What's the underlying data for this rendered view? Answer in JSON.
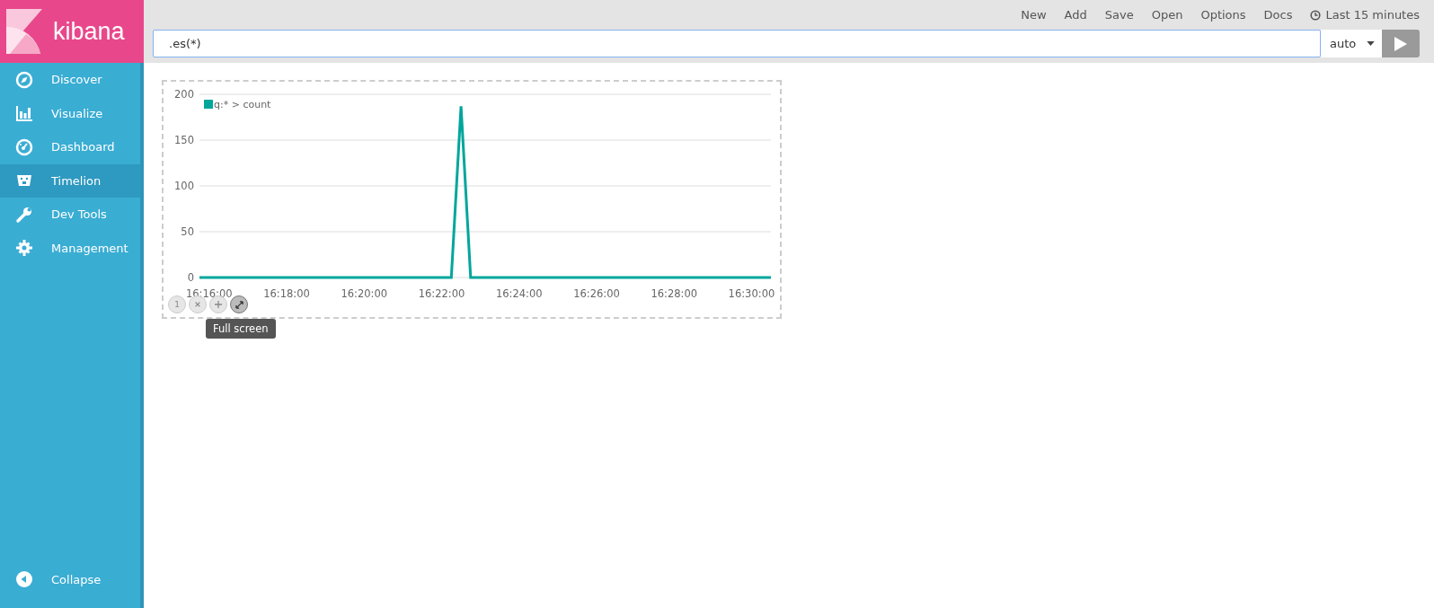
{
  "brand": {
    "name": "kibana"
  },
  "nav": [
    {
      "label": "Discover",
      "kind": "compass",
      "selected": false
    },
    {
      "label": "Visualize",
      "kind": "bars",
      "selected": false
    },
    {
      "label": "Dashboard",
      "kind": "gauge",
      "selected": false
    },
    {
      "label": "Timelion",
      "kind": "bear",
      "selected": true
    },
    {
      "label": "Dev Tools",
      "kind": "wrench",
      "selected": false
    },
    {
      "label": "Management",
      "kind": "gear",
      "selected": false
    }
  ],
  "collapse": {
    "label": "Collapse"
  },
  "top_menu": [
    "New",
    "Add",
    "Save",
    "Open",
    "Options",
    "Docs"
  ],
  "time_range": "Last 15 minutes",
  "expression": {
    "value": ".es(*)"
  },
  "interval": {
    "value": "auto"
  },
  "chart_controls": [
    {
      "label": "1"
    }
  ],
  "tooltip": "Full screen",
  "chart_data": {
    "type": "line",
    "categories": [
      null,
      "16:16:00",
      null,
      null,
      null,
      null,
      null,
      null,
      null,
      "16:18:00",
      null,
      null,
      null,
      null,
      null,
      null,
      null,
      "16:20:00",
      null,
      null,
      null,
      null,
      null,
      null,
      null,
      "16:22:00",
      null,
      null,
      null,
      null,
      null,
      null,
      null,
      "16:24:00",
      null,
      null,
      null,
      null,
      null,
      null,
      null,
      "16:26:00",
      null,
      null,
      null,
      null,
      null,
      null,
      null,
      "16:28:00",
      null,
      null,
      null,
      null,
      null,
      null,
      null,
      "16:30:00",
      null,
      null
    ],
    "series": [
      {
        "name": "q:* > count",
        "color": "#00a69b",
        "values": [
          0,
          0,
          0,
          0,
          0,
          0,
          0,
          0,
          0,
          0,
          0,
          0,
          0,
          0,
          0,
          0,
          0,
          0,
          0,
          0,
          0,
          0,
          0,
          0,
          0,
          0,
          0,
          187,
          0,
          0,
          0,
          0,
          0,
          0,
          0,
          0,
          0,
          0,
          0,
          0,
          0,
          0,
          0,
          0,
          0,
          0,
          0,
          0,
          0,
          0,
          0,
          0,
          0,
          0,
          0,
          0,
          0,
          0,
          0,
          0
        ]
      }
    ],
    "ylim": [
      0,
      200
    ],
    "grid": true,
    "yticks": [
      0,
      50,
      100,
      150,
      200
    ]
  }
}
